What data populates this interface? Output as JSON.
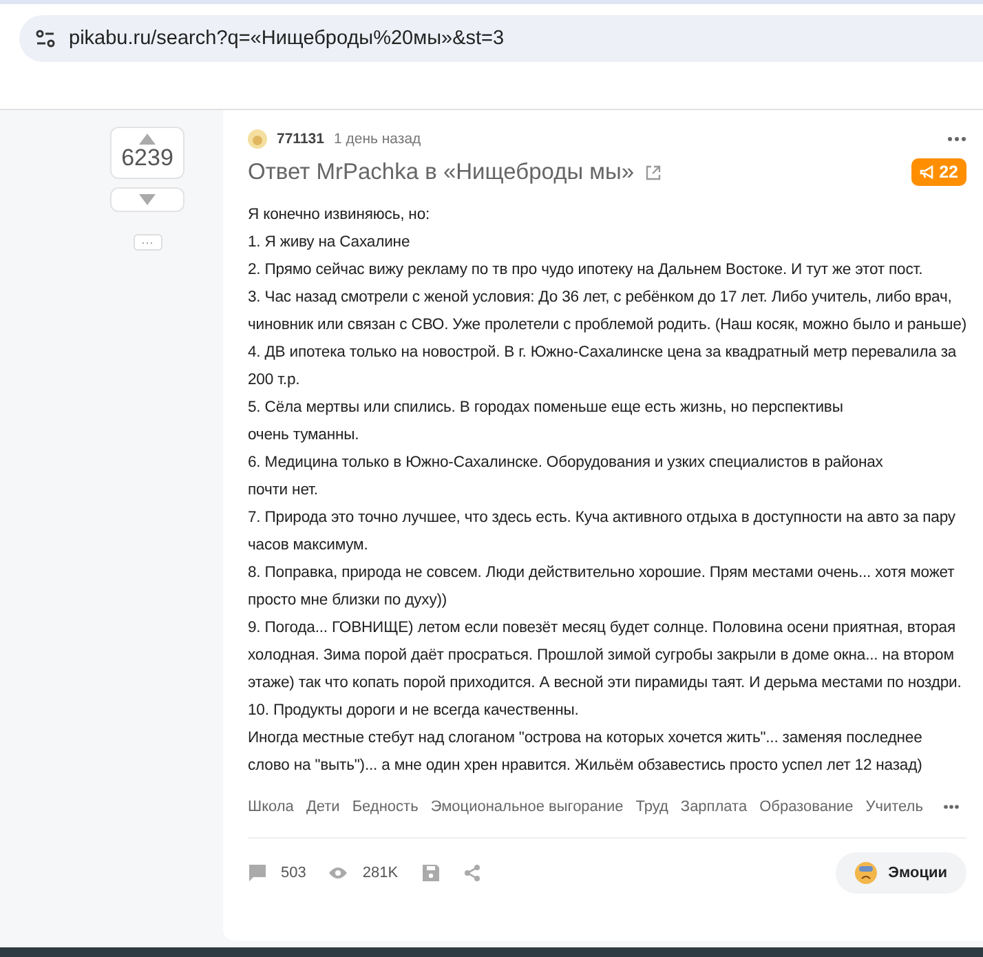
{
  "address_bar": {
    "url": "pikabu.ru/search?q=«Нищеброды%20мы»&st=3"
  },
  "vote": {
    "score": "6239",
    "more": "···"
  },
  "post": {
    "author": "771131",
    "time": "1 день назад",
    "title": "Ответ MrPachka в «Нищеброды мы»",
    "badge": "22",
    "lines": [
      "Я конечно извиняюсь, но:",
      "1. Я живу на Сахалине",
      "2. Прямо сейчас вижу рекламу по тв про чудо ипотеку на Дальнем Востоке. И тут же этот пост.",
      "3. Час назад смотрели с женой условия: До 36 лет, с ребёнком до 17 лет. Либо учитель, либо врач, чиновник или связан с СВО. Уже пролетели с проблемой родить. (Наш косяк, можно было и раньше)",
      "4. ДВ ипотека только на новострой. В г. Южно-Сахалинске цена за квадратный метр перевалила за 200 т.р.",
      "5. Сёла мертвы или спились. В городах поменьше еще есть жизнь, но перспективы",
      "очень туманны.",
      "6. Медицина только в Южно-Сахалинске. Оборудования и узких специалистов в районах",
      "почти нет.",
      "7. Природа это точно лучшее, что здесь есть. Куча активного отдыха в доступности на авто за пару часов максимум.",
      "8. Поправка, природа не совсем. Люди действительно хорошие. Прям местами очень... хотя может просто мне близки по духу))",
      "9. Погода... ГОВНИЩЕ) летом если повезёт месяц будет солнце. Половина осени приятная, вторая холодная. Зима порой даёт просраться. Прошлой зимой сугробы закрыли в доме окна... на втором этаже) так что копать порой приходится. А весной эти пирамиды таят. И дерьма местами по ноздри.",
      "10. Продукты дороги и не всегда качественны.",
      "Иногда местные стебут над слоганом \"острова на которых хочется жить\"... заменяя последнее слово на \"выть\")... а мне один хрен нравится. Жильём обзавестись просто успел лет 12 назад)"
    ],
    "tags": [
      "Школа",
      "Дети",
      "Бедность",
      "Эмоциональное выгорание",
      "Труд",
      "Зарплата",
      "Образование",
      "Учитель"
    ],
    "comments": "503",
    "views": "281K",
    "emotions": "Эмоции"
  }
}
